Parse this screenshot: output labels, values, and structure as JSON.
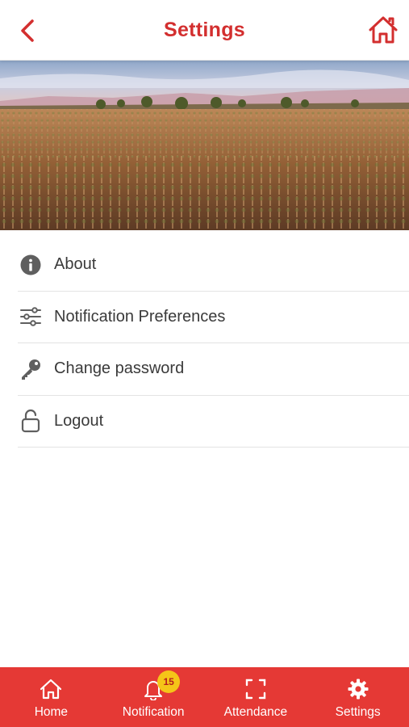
{
  "header": {
    "title": "Settings"
  },
  "menu": {
    "items": [
      {
        "label": "About",
        "icon": "info-icon"
      },
      {
        "label": "Notification Preferences",
        "icon": "sliders-icon"
      },
      {
        "label": "Change password",
        "icon": "key-icon"
      },
      {
        "label": "Logout",
        "icon": "unlock-icon"
      }
    ]
  },
  "bottom_nav": {
    "items": [
      {
        "label": "Home",
        "icon": "home-icon"
      },
      {
        "label": "Notification",
        "icon": "bell-icon",
        "badge": "15"
      },
      {
        "label": "Attendance",
        "icon": "scan-icon"
      },
      {
        "label": "Settings",
        "icon": "gear-icon",
        "active": true
      }
    ]
  },
  "colors": {
    "accent": "#d32f2f",
    "nav_background": "#e53935",
    "badge": "#f5c518"
  }
}
